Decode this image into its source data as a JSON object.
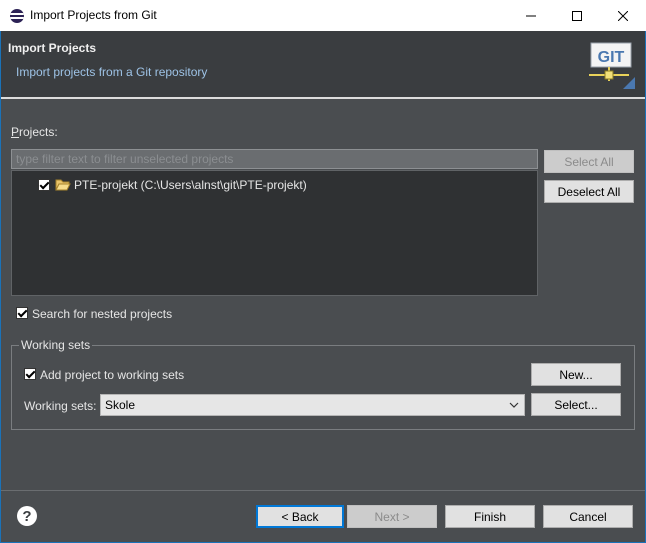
{
  "window": {
    "title": "Import Projects from Git",
    "minimize_label": "—",
    "maximize_label": "☐",
    "close_label": "✕"
  },
  "header": {
    "title": "Import Projects",
    "subtitle": "Import projects from a Git repository",
    "logo_text": "GIT"
  },
  "projects": {
    "label": "Projects:",
    "filter_placeholder": "type filter text to filter unselected projects",
    "filter_value": "",
    "items": [
      {
        "label": "PTE-projekt (C:\\Users\\alnst\\git\\PTE-projekt)",
        "checked": true
      }
    ],
    "select_all_label": "Select All",
    "deselect_all_label": "Deselect All"
  },
  "options": {
    "search_nested_label": "Search for nested projects",
    "search_nested_checked": true
  },
  "working_sets": {
    "group_title": "Working sets",
    "add_label": "Add project to working sets",
    "add_checked": true,
    "new_label": "New...",
    "sets_label": "Working sets:",
    "sets_value": "Skole",
    "select_label": "Select..."
  },
  "footer": {
    "help_label": "?",
    "back_label": "< Back",
    "next_label": "Next >",
    "finish_label": "Finish",
    "cancel_label": "Cancel"
  },
  "colors": {
    "background": "#4a4d50",
    "header": "#3a3d40",
    "tree_background": "#2f3133",
    "subtitle": "#9ec3e6",
    "accent": "#0078d7"
  }
}
